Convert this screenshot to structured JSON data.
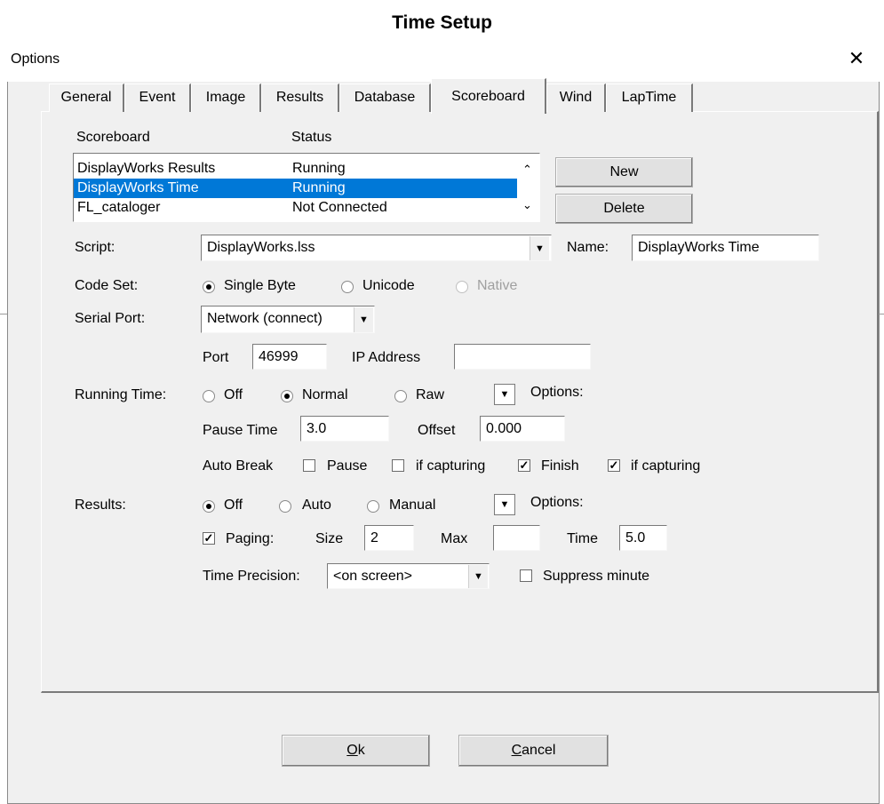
{
  "page_title": "Time Setup",
  "window": {
    "title": "Options",
    "close_icon": "close-icon"
  },
  "tabs": [
    {
      "label": "General"
    },
    {
      "label": "Event"
    },
    {
      "label": "Image"
    },
    {
      "label": "Results"
    },
    {
      "label": "Database"
    },
    {
      "label": "Scoreboard",
      "active": true
    },
    {
      "label": "Wind"
    },
    {
      "label": "LapTime"
    }
  ],
  "scoreboard_list": {
    "col_scoreboard": "Scoreboard",
    "col_status": "Status",
    "rows": [
      {
        "name": "DisplayWorks Results",
        "status": "Running"
      },
      {
        "name": "DisplayWorks Time",
        "status": "Running",
        "selected": true
      },
      {
        "name": "FL_cataloger",
        "status": "Not Connected"
      }
    ]
  },
  "buttons": {
    "new": "New",
    "delete": "Delete",
    "ok_rest": "k",
    "ok_mnemonic": "O",
    "cancel_mnemonic": "C",
    "cancel_rest": "ancel"
  },
  "script": {
    "label": "Script:",
    "value": "DisplayWorks.lss"
  },
  "name": {
    "label": "Name:",
    "value": "DisplayWorks Time"
  },
  "code_set": {
    "label": "Code Set:",
    "options": [
      "Single Byte",
      "Unicode",
      "Native"
    ],
    "selected": "Single Byte",
    "disabled": [
      "Native"
    ]
  },
  "serial_port": {
    "label": "Serial Port:",
    "value": "Network (connect)",
    "port_label": "Port",
    "port_value": "46999",
    "ip_label": "IP Address",
    "ip_value": ""
  },
  "running_time": {
    "label": "Running Time:",
    "options": [
      "Off",
      "Normal",
      "Raw"
    ],
    "selected": "Normal",
    "options_label": "Options:",
    "pause_label": "Pause Time",
    "pause_value": "3.0",
    "offset_label": "Offset",
    "offset_value": "0.000",
    "auto_break_label": "Auto Break",
    "pause_check": "Pause",
    "pause_checked": false,
    "if_capturing_1": "if capturing",
    "if_capturing_1_checked": false,
    "finish_check": "Finish",
    "finish_checked": true,
    "if_capturing_2": "if capturing",
    "if_capturing_2_checked": true
  },
  "results": {
    "label": "Results:",
    "options": [
      "Off",
      "Auto",
      "Manual"
    ],
    "selected": "Off",
    "options_label": "Options:",
    "paging_label": "Paging:",
    "paging_checked": true,
    "size_label": "Size",
    "size_value": "2",
    "max_label": "Max",
    "max_value": "",
    "time_label": "Time",
    "time_value": "5.0",
    "precision_label": "Time Precision:",
    "precision_value": "<on screen>",
    "suppress_label": "Suppress minute",
    "suppress_checked": false
  },
  "colors": {
    "selection": "#0078d7",
    "dialog_bg": "#f0f0f0"
  }
}
